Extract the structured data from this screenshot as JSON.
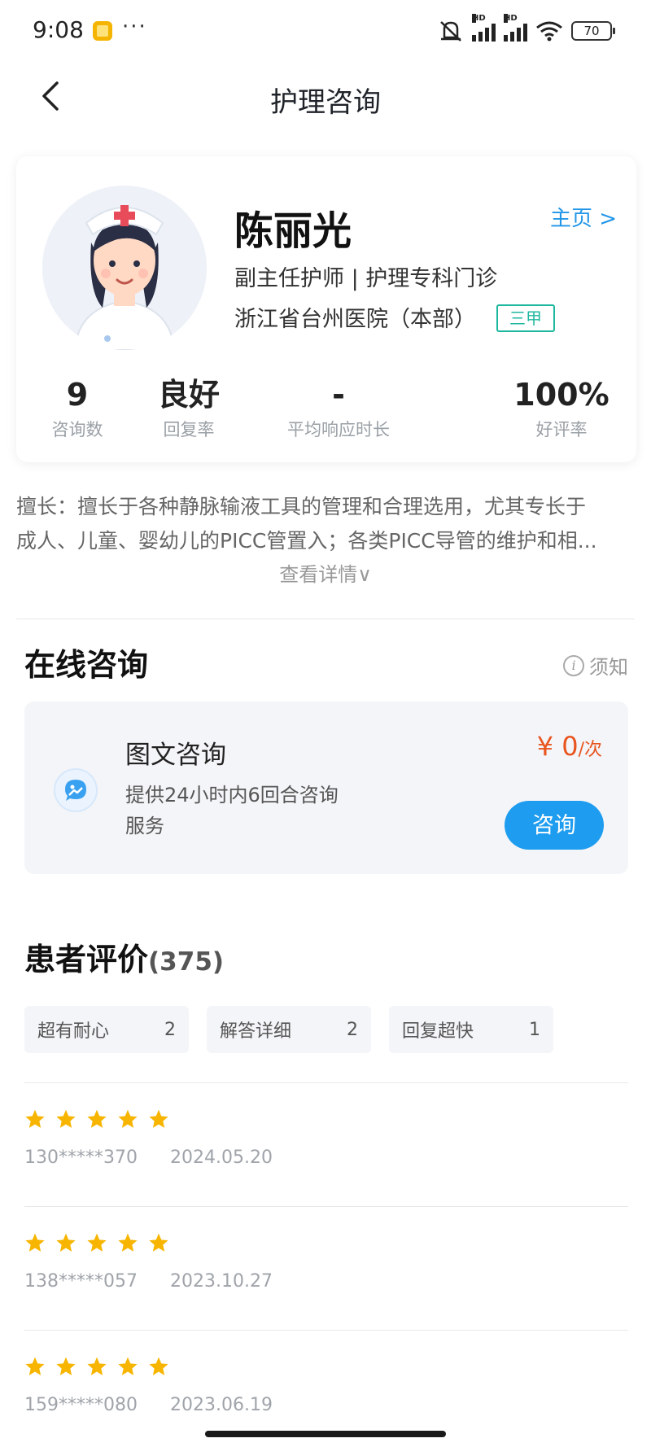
{
  "status_bar": {
    "time": "9:08",
    "dots": "···",
    "battery": "70"
  },
  "nav": {
    "title": "护理咨询"
  },
  "doctor": {
    "name": "陈丽光",
    "homepage_label": "主页 >",
    "title": "副主任护师 | 护理专科门诊",
    "hospital": "浙江省台州医院（本部）",
    "grade": "三甲",
    "stats": [
      {
        "value": "9",
        "label": "咨询数"
      },
      {
        "value": "良好",
        "label": "回复率"
      },
      {
        "value": "-",
        "label": "平均响应时长"
      },
      {
        "value": "100%",
        "label": "好评率"
      }
    ]
  },
  "expertise": {
    "line1": "擅长：擅长于各种静脉输液工具的管理和合理选用，尤其专长于",
    "line2": "成人、儿童、婴幼儿的PICC管置入；各类PICC导管的维护和相...",
    "expand_label": "查看详情∨"
  },
  "online_consult": {
    "title": "在线咨询",
    "notice_label": "须知",
    "card": {
      "name": "图文咨询",
      "desc": "提供24小时内6回合咨询服务",
      "price_value": "¥ 0",
      "price_unit": "/次",
      "button_label": "咨询"
    }
  },
  "reviews": {
    "title": "患者评价",
    "count": "(375)",
    "tags": [
      {
        "label": "超有耐心",
        "count": "2"
      },
      {
        "label": "解答详细",
        "count": "2"
      },
      {
        "label": "回复超快",
        "count": "1"
      }
    ],
    "items": [
      {
        "rating": 5,
        "user": "130*****370",
        "date": "2024.05.20"
      },
      {
        "rating": 5,
        "user": "138*****057",
        "date": "2023.10.27"
      },
      {
        "rating": 5,
        "user": "159*****080",
        "date": "2023.06.19"
      }
    ]
  },
  "colors": {
    "accent_blue": "#1e9cef",
    "price_orange": "#e8541e",
    "badge_green": "#1fb89f",
    "star_yellow": "#f7b500"
  }
}
